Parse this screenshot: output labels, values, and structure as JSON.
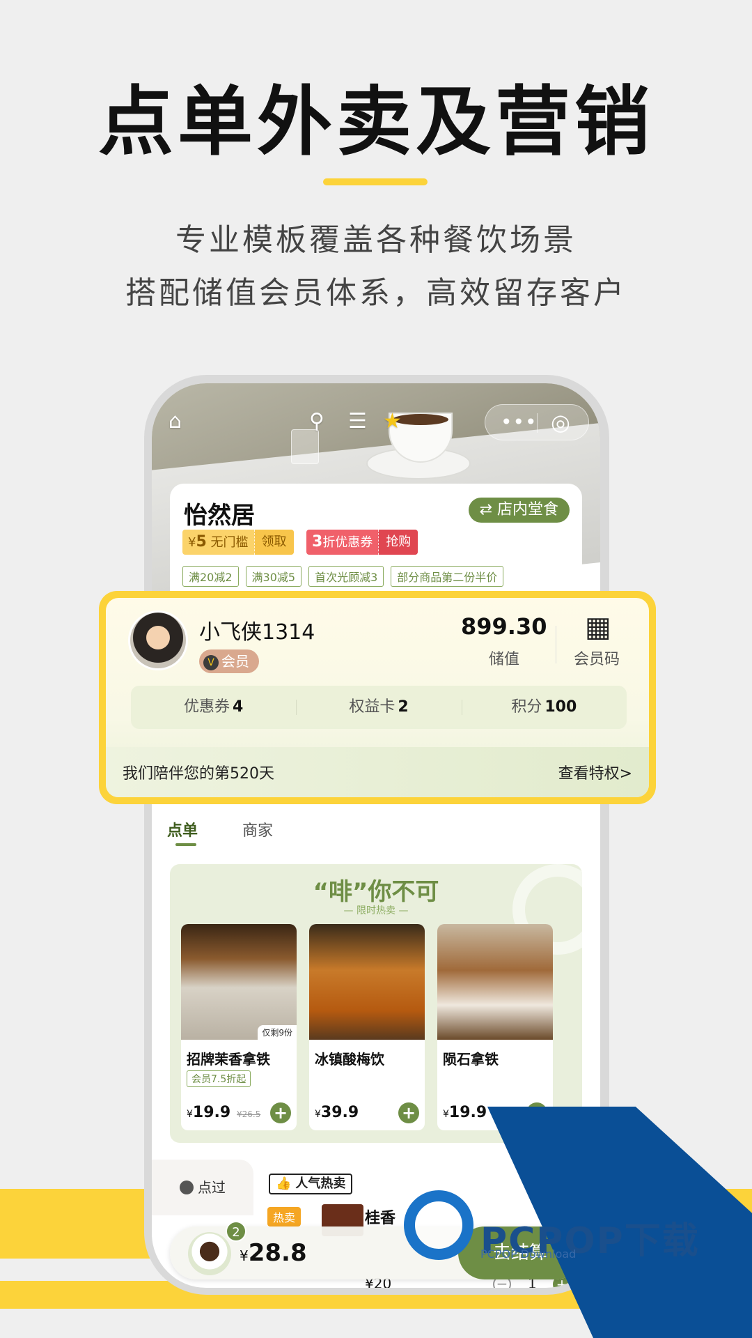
{
  "headline": "点单外卖及营销",
  "subline_1": "专业模板覆盖各种餐饮场景",
  "subline_2": "搭配储值会员体系，高效留存客户",
  "nav_icons": [
    "home-icon",
    "search-icon",
    "list-icon",
    "star-icon",
    "more-icon",
    "target-icon"
  ],
  "store": {
    "name": "怡然居",
    "mode_button": "⇄ 店内堂食",
    "coupon_1": {
      "currency": "¥",
      "amount": "5",
      "desc": "无门槛",
      "action": "领取"
    },
    "coupon_2": {
      "amount": "3",
      "desc": "折优惠券",
      "action": "抢购"
    },
    "tags": [
      "满20减2",
      "满30减5",
      "首次光顾减3",
      "部分商品第二份半价"
    ]
  },
  "member": {
    "username": "小飞侠1314",
    "level": "会员",
    "level_badge": "V",
    "balance_value": "899.30",
    "balance_label": "储值",
    "qr_label": "会员码",
    "stats": [
      {
        "label": "优惠券",
        "value": "4"
      },
      {
        "label": "权益卡",
        "value": "2"
      },
      {
        "label": "积分",
        "value": "100"
      }
    ],
    "days_text": "我们陪伴您的第520天",
    "privilege_link": "查看特权>"
  },
  "tabs": [
    "点单",
    "商家"
  ],
  "promo": {
    "title": "“啡”你不可",
    "subtitle": "— 限时热卖 —",
    "products": [
      {
        "name": "招牌茉香拿铁",
        "tag": "会员7.5折起",
        "currency": "¥",
        "price": "19.9",
        "original_price": "¥26.5",
        "badge": "仅剩9份"
      },
      {
        "name": "冰镇酸梅饮",
        "currency": "¥",
        "price": "39.9"
      },
      {
        "name": "陨石拿铁",
        "currency": "¥",
        "price": "19.9"
      }
    ]
  },
  "sidebar": {
    "item": "点过"
  },
  "section_label": "人气热卖",
  "hot_item": {
    "tag": "热卖",
    "name": "桂香",
    "price": "¥20",
    "quantity": "1"
  },
  "cart": {
    "count": "2",
    "currency": "¥",
    "total": "28.8",
    "checkout": "去结算"
  },
  "watermark": {
    "text": "PCPOP下载",
    "sub": "PCPOP Download"
  },
  "colors": {
    "accent_yellow": "#fcd33a",
    "brand_green": "#6e8e45",
    "coupon_red": "#f0606a",
    "watermark_blue": "#0a4f96"
  }
}
